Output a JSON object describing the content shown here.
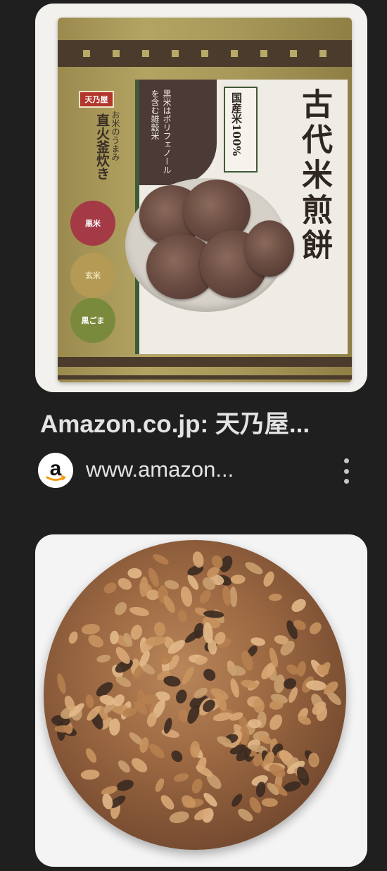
{
  "results": [
    {
      "title": "Amazon.co.jp: 天乃屋...",
      "source": "www.amazon...",
      "favicon_icon": "amazon-logo-icon",
      "package_text": {
        "brand": "天乃屋",
        "product_name": "古代米煎餅",
        "label_box": "国産米100%",
        "blob_text": "黒米はポリフェノールを含む雑穀米",
        "side_text": "直火釜炊き",
        "side_sub": "お米のうまみ",
        "circles": [
          "黒米",
          "玄米",
          "黒ごま"
        ]
      }
    },
    {
      "image_icon": "rice-cracker-image"
    }
  ],
  "colors": {
    "background": "#1f1f1f",
    "text": "#e3e3e3"
  }
}
